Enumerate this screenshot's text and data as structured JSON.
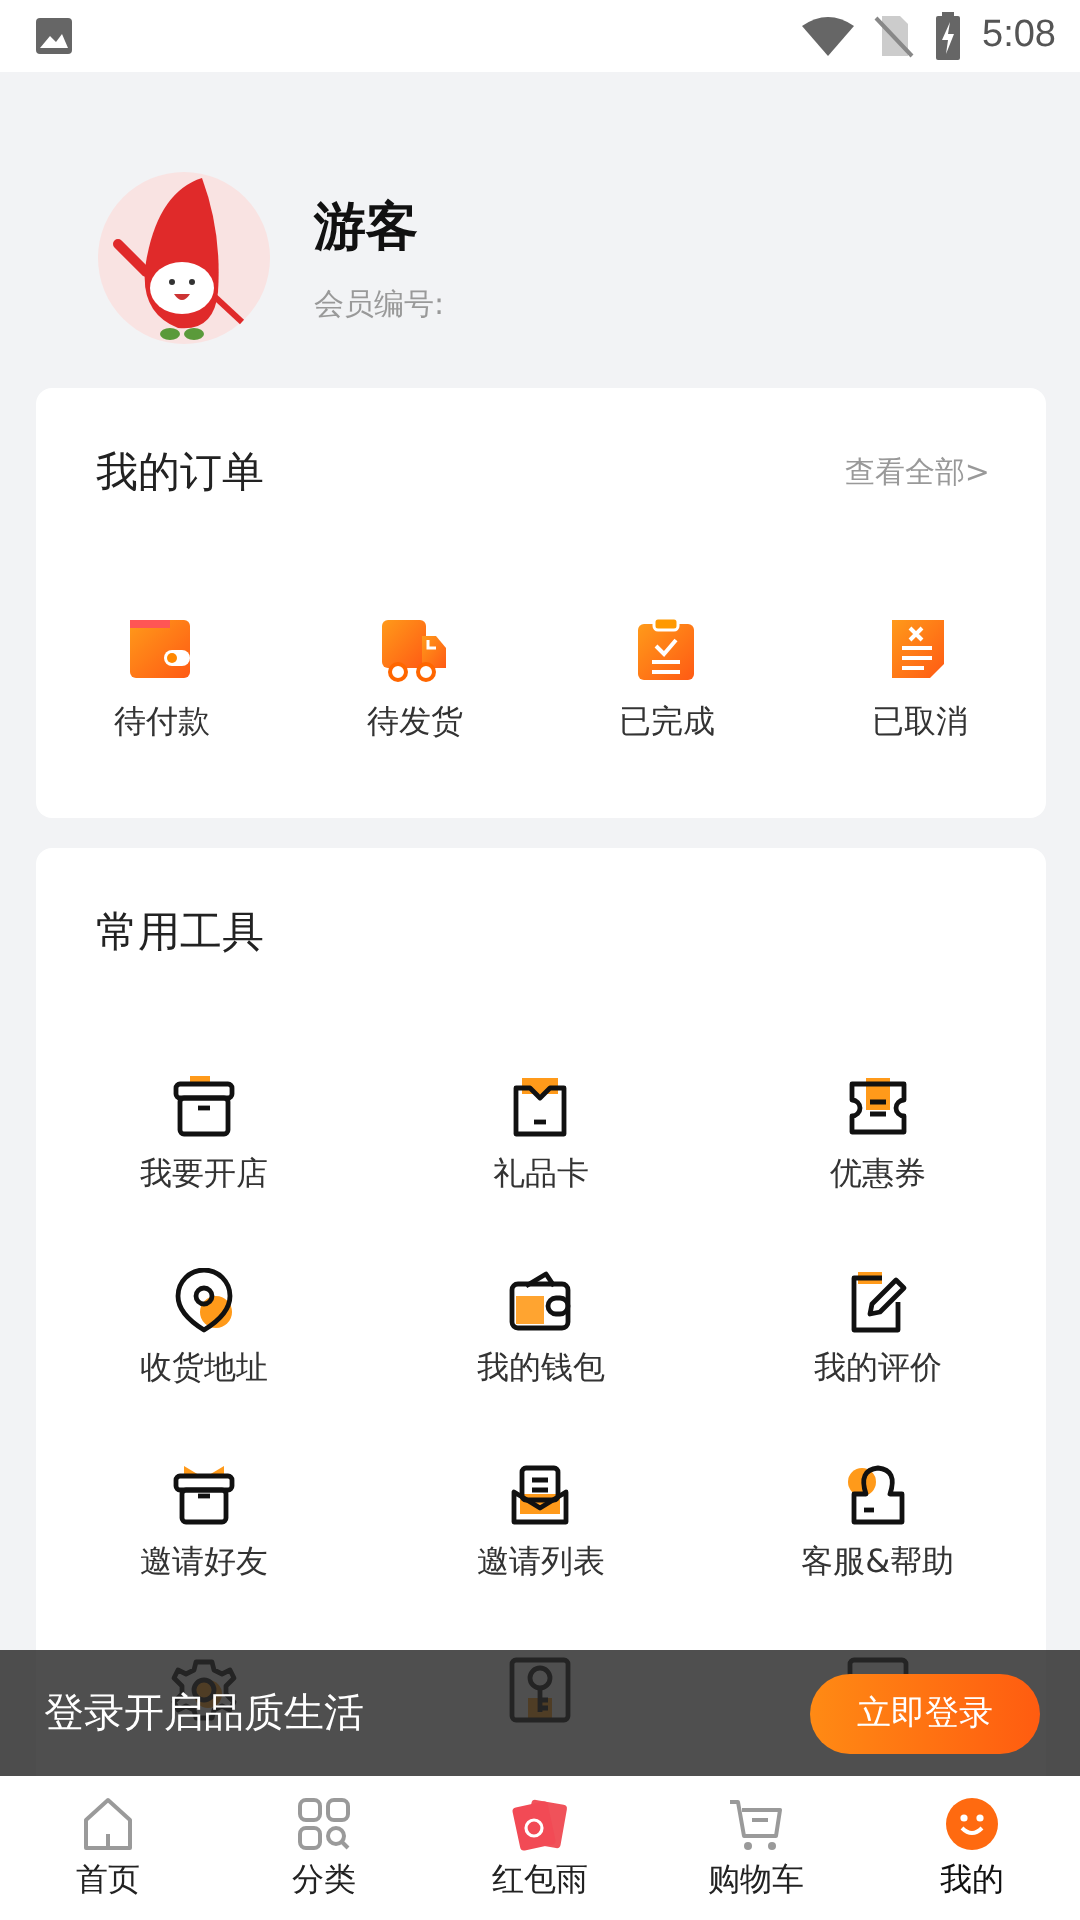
{
  "status_bar": {
    "time": "5:08"
  },
  "profile": {
    "name": "游客",
    "member_label": "会员编号:"
  },
  "orders": {
    "title": "我的订单",
    "view_all": "查看全部>",
    "items": [
      {
        "label": "待付款"
      },
      {
        "label": "待发货"
      },
      {
        "label": "已完成"
      },
      {
        "label": "已取消"
      }
    ]
  },
  "tools": {
    "title": "常用工具",
    "items": [
      {
        "kind": "labeled",
        "label": "我要开店"
      },
      {
        "kind": "labeled",
        "label": "礼品卡"
      },
      {
        "kind": "labeled",
        "label": "优惠券"
      },
      {
        "kind": "labeled",
        "label": "收货地址"
      },
      {
        "kind": "labeled",
        "label": "我的钱包"
      },
      {
        "kind": "labeled",
        "label": "我的评价"
      },
      {
        "kind": "labeled",
        "label": "邀请好友"
      },
      {
        "kind": "labeled",
        "label": "邀请列表"
      },
      {
        "kind": "labeled",
        "label": "客服&帮助"
      },
      {
        "kind": "icon"
      },
      {
        "kind": "icon"
      },
      {
        "kind": "icon"
      }
    ]
  },
  "login_banner": {
    "text": "登录开启品质生活",
    "button": "立即登录"
  },
  "tab_bar": [
    {
      "label": "首页",
      "selected": false
    },
    {
      "label": "分类",
      "selected": false
    },
    {
      "label": "红包雨",
      "selected": false
    },
    {
      "label": "购物车",
      "selected": false
    },
    {
      "label": "我的",
      "selected": true
    }
  ]
}
